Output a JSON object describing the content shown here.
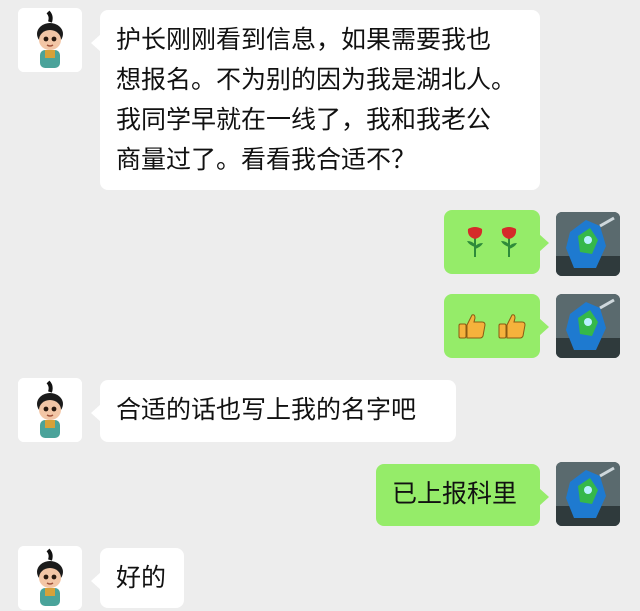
{
  "colors": {
    "background": "#ededed",
    "incoming_bubble": "#ffffff",
    "outgoing_bubble": "#95ec69"
  },
  "messages": [
    {
      "side": "in",
      "lines": [
        "护长刚刚看到信息，如果需要我也",
        "想报名。不为别的因为我是湖北人。",
        "我同学早就在一线了，我和我老公",
        "商量过了。看看我合适不？"
      ]
    },
    {
      "side": "out",
      "emoji": [
        "rose",
        "rose"
      ]
    },
    {
      "side": "out",
      "emoji": [
        "thumbs-up",
        "thumbs-up"
      ]
    },
    {
      "side": "in",
      "lines": [
        "合适的话也写上我的名字吧"
      ]
    },
    {
      "side": "out",
      "lines": [
        "已上报科里"
      ]
    },
    {
      "side": "in",
      "lines": [
        "好的"
      ]
    }
  ]
}
